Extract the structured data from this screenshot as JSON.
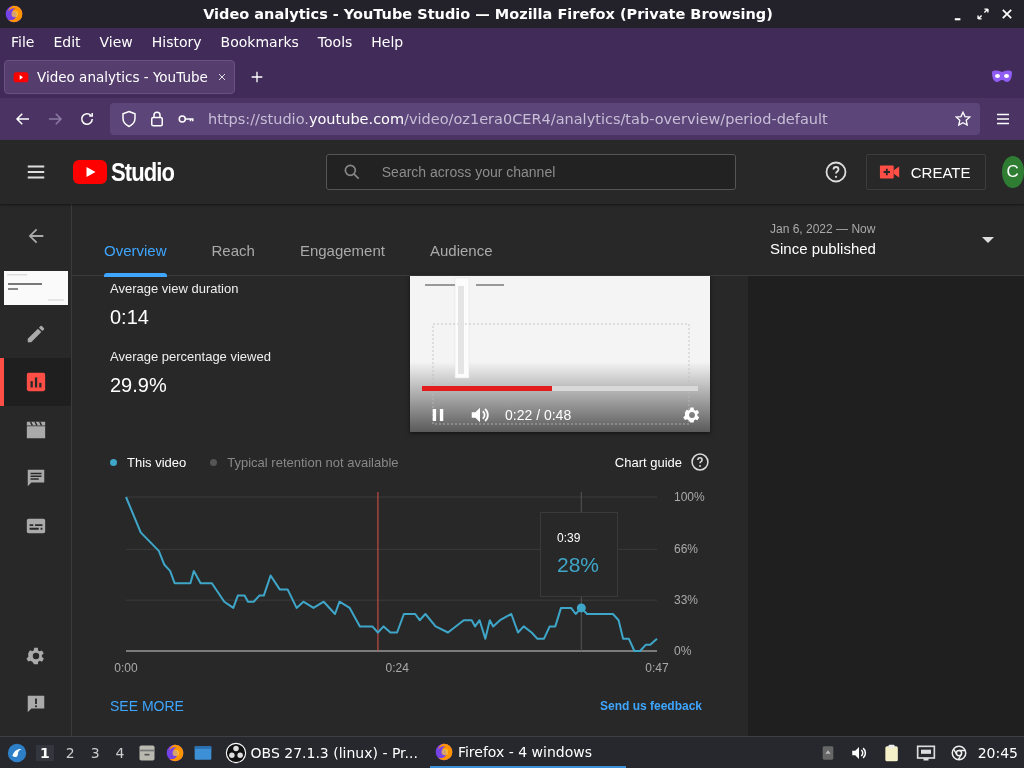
{
  "window": {
    "title": "Video analytics - YouTube Studio — Mozilla Firefox (Private Browsing)"
  },
  "menu": [
    "File",
    "Edit",
    "View",
    "History",
    "Bookmarks",
    "Tools",
    "Help"
  ],
  "browser_tabs": [
    {
      "title": "Video analytics - YouTube",
      "selected": true
    }
  ],
  "navigation": {
    "forward_disabled": true,
    "url_parts": [
      {
        "text": "https://studio.",
        "emphasis": false
      },
      {
        "text": "youtube.com",
        "emphasis": true
      },
      {
        "text": "/video/oz1era0CER4/analytics/tab-overview/period-default",
        "emphasis": false
      }
    ]
  },
  "studio_header": {
    "logo_text": "Studio",
    "search_placeholder": "Search across your channel",
    "create_label": "CREATE",
    "avatar_letter": "C"
  },
  "sidebar": {
    "items": [
      {
        "kind": "back",
        "selected": false
      },
      {
        "kind": "thumbnail",
        "selected": false
      },
      {
        "kind": "edit",
        "selected": false
      },
      {
        "kind": "analytics",
        "selected": true
      },
      {
        "kind": "content",
        "selected": false
      },
      {
        "kind": "comments",
        "selected": false
      },
      {
        "kind": "subtitles",
        "selected": false
      }
    ],
    "bottom_items": [
      {
        "kind": "settings",
        "selected": false
      },
      {
        "kind": "feedback",
        "selected": false
      }
    ]
  },
  "tabs": [
    {
      "label": "Overview",
      "selected": true
    },
    {
      "label": "Reach",
      "selected": false
    },
    {
      "label": "Engagement",
      "selected": false
    },
    {
      "label": "Audience",
      "selected": false
    }
  ],
  "period": {
    "range": "Jan 6, 2022 — Now",
    "label": "Since published"
  },
  "metrics": [
    {
      "label": "Average view duration",
      "value": "0:14"
    },
    {
      "label": "Average percentage viewed",
      "value": "29.9%"
    }
  ],
  "player": {
    "kind": "picture",
    "playing": true,
    "level": 0.47,
    "time": "0:22 / 0:48"
  },
  "retention": {
    "legend": [
      {
        "label": "Typical retention not available",
        "color": "#555555",
        "disabled": true
      }
    ],
    "chart_guide": "Chart guide",
    "chart_data": {
      "type": "line",
      "x": [
        0,
        0.4,
        1.3,
        2.9,
        3.4,
        3.9,
        4.3,
        5.7,
        6.0,
        6.6,
        7.6,
        8.7,
        9.5,
        9.9,
        10.5,
        10.8,
        11.3,
        11.8,
        12.2,
        12.8,
        13.6,
        14.3,
        15.1,
        15.7,
        16.6,
        17.5,
        18.5,
        18.9,
        19.8,
        20.7,
        21.8,
        22.3,
        22.8,
        23.4,
        24,
        24.6,
        25.6,
        26,
        26.5,
        27.4,
        28.5,
        29.9,
        30.6,
        30.9,
        31.3,
        31.8,
        32.2,
        32.5,
        33.1,
        34.1,
        34.7,
        35.2,
        35.9,
        36.4,
        37,
        37.5,
        38,
        38.5,
        39.4,
        39.8,
        40.3,
        40.8,
        43.1,
        43.6,
        44,
        44.5,
        45,
        45.5,
        46,
        46.4,
        47
      ],
      "series": [
        {
          "name": "This video",
          "color": "#3ea6c8",
          "values": [
            100,
            93,
            77,
            65,
            56,
            52,
            44,
            44,
            52,
            44,
            44,
            32,
            28,
            36,
            36,
            32,
            32,
            36,
            36,
            49,
            40,
            40,
            28,
            32,
            28,
            32,
            24,
            32,
            28,
            16,
            16,
            12,
            16,
            12,
            12,
            24,
            24,
            20,
            24,
            16,
            12,
            20,
            20,
            16,
            20,
            8,
            20,
            16,
            20,
            24,
            12,
            16,
            12,
            8,
            8,
            16,
            16,
            28,
            28,
            24,
            28,
            24,
            24,
            20,
            8,
            8,
            0,
            0,
            4,
            4,
            8
          ]
        }
      ],
      "xlim": [
        0,
        47
      ],
      "ylim": [
        0,
        100
      ],
      "grid": true,
      "xticks": [
        {
          "value": 0,
          "label": "0:00"
        },
        {
          "value": 24,
          "label": "0:24"
        },
        {
          "value": 47,
          "label": "0:47"
        }
      ],
      "yticks": [
        {
          "value": 0,
          "label": "0%"
        },
        {
          "value": 33,
          "label": "33%"
        },
        {
          "value": 66,
          "label": "66%"
        },
        {
          "value": 100,
          "label": "100%"
        }
      ],
      "ref_lines": [
        {
          "axis": "x",
          "value": 22.3,
          "color": "#e0524a"
        },
        {
          "axis": "x",
          "value": 40.3,
          "color": "#555555"
        }
      ],
      "annotations": [
        {
          "x": 40.3,
          "y": 28,
          "text": "28%"
        }
      ]
    },
    "tooltip_time": "0:39",
    "see_more": "SEE MORE",
    "feedback": "Send us feedback"
  },
  "taskbar": {
    "workspaces": [
      {
        "label": "1",
        "selected": true
      },
      {
        "label": "2",
        "selected": false
      },
      {
        "label": "3",
        "selected": false
      },
      {
        "label": "4",
        "selected": false
      }
    ],
    "launchers": [
      {
        "kind": "files"
      },
      {
        "kind": "firefox"
      },
      {
        "kind": "window"
      }
    ],
    "apps": [
      {
        "kind": "obs",
        "label": "OBS 27.1.3 (linux) - Pr...",
        "selected": false
      },
      {
        "kind": "firefox",
        "label": "Firefox - 4 windows",
        "selected": true
      }
    ],
    "clock": "20:45"
  }
}
